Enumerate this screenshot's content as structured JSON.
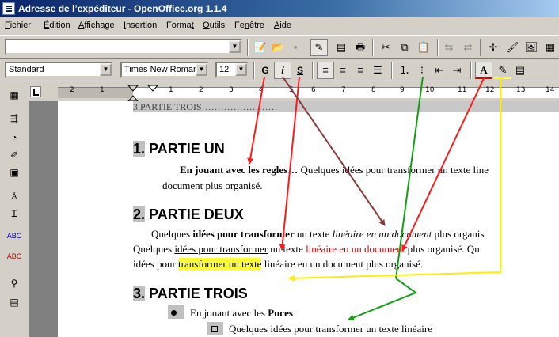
{
  "window": {
    "title": "Adresse de l’expéditeur - OpenOffice.org 1.1.4"
  },
  "menu": [
    {
      "pre": "",
      "u": "F",
      "post": "ichier"
    },
    {
      "pre": "",
      "u": "É",
      "post": "dition"
    },
    {
      "pre": "",
      "u": "A",
      "post": "ffichage"
    },
    {
      "pre": "",
      "u": "I",
      "post": "nsertion"
    },
    {
      "pre": "Forma",
      "u": "t",
      "post": ""
    },
    {
      "pre": "",
      "u": "O",
      "post": "utils"
    },
    {
      "pre": "Fe",
      "u": "n",
      "post": "être"
    },
    {
      "pre": "",
      "u": "A",
      "post": "ide"
    }
  ],
  "toolbar": {
    "url_value": "",
    "paragraph_style": "Standard",
    "font_name": "Times New Roman",
    "font_size": "12",
    "bold_label": "G",
    "italic_label": "i",
    "underline_label": "S"
  },
  "ruler": {
    "ticks": [
      "2",
      "1",
      "1",
      "2",
      "3",
      "4",
      "5",
      "6",
      "7",
      "8",
      "9",
      "10",
      "11",
      "12",
      "13",
      "14"
    ]
  },
  "document": {
    "field_line": "3.PARTIE TROIS……………………",
    "h1_num": "1.",
    "h1_text": "PARTIE UN",
    "p1_bold": "En jouant avec les regles…",
    "p1_rest": " Quelques idées pour transformer un texte line",
    "p1_line2": "document plus organisé.",
    "h2_num": "2.",
    "h2_text": "PARTIE DEUX",
    "p2_a": "Quelques ",
    "p2_bold": "idées pour transformer",
    "p2_b": " un texte ",
    "p2_italic": "linéaire en un document",
    "p2_c": " plus organis",
    "p3_a": "Quelques ",
    "p3_u": "idées pour transformer",
    "p3_b": " un texte ",
    "p3_red": "linéaire en un document",
    "p3_c": " plus organisé. Qu",
    "p4_a": "idées pour ",
    "p4_hl": "transformer un texte",
    "p4_b": " linéaire en un document plus organisé.",
    "h3_num": "3.",
    "h3_text": "PARTIE TROIS",
    "bullet1_a": "En jouant avec les ",
    "bullet1_bold": "Puces",
    "bullet2": "Quelques idées pour transformer un texte linéaire"
  },
  "colors": {
    "arrow_red": "#ff1a1a",
    "arrow_brown": "#8b3a3a",
    "arrow_green": "#129e12",
    "arrow_yellow": "#ffee00",
    "highlight": "#ffff33",
    "red_text": "#d40000"
  }
}
